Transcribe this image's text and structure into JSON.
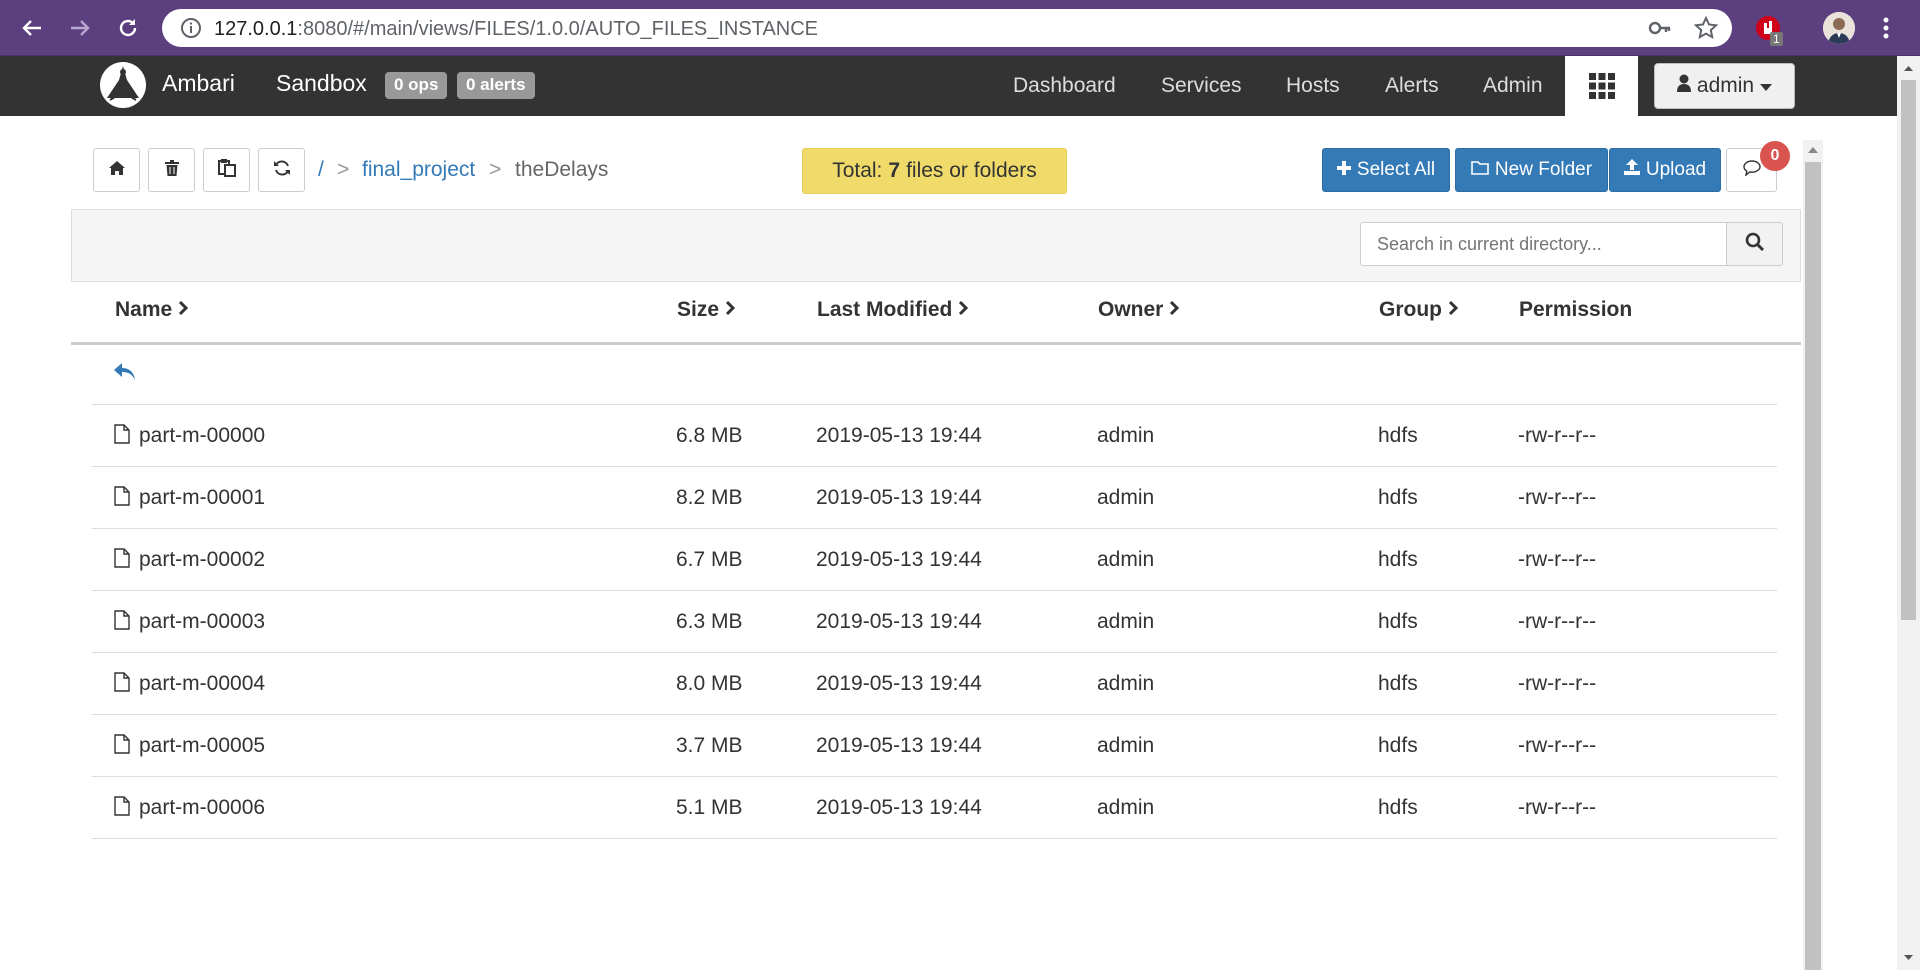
{
  "browser": {
    "url_host": "127.0.0.1",
    "url_rest": ":8080/#/main/views/FILES/1.0.0/AUTO_FILES_INSTANCE",
    "extension_badge": "1"
  },
  "nav": {
    "brand": "Ambari",
    "cluster": "Sandbox",
    "ops_badge": "0 ops",
    "alerts_badge": "0 alerts",
    "links": [
      "Dashboard",
      "Services",
      "Hosts",
      "Alerts",
      "Admin"
    ],
    "user": "admin"
  },
  "breadcrumb": {
    "root": "/",
    "sep": ">",
    "folder": "final_project",
    "current": "theDelays"
  },
  "total": {
    "prefix": "Total:",
    "count": "7",
    "suffix": "files or folders"
  },
  "toolbar": {
    "select_all": "Select All",
    "new_folder": "New Folder",
    "upload": "Upload",
    "messages_count": "0"
  },
  "search": {
    "placeholder": "Search in current directory..."
  },
  "table": {
    "headers": [
      "Name",
      "Size",
      "Last Modified",
      "Owner",
      "Group",
      "Permission"
    ],
    "rows": [
      {
        "name": "part-m-00000",
        "size": "6.8 MB",
        "modified": "2019-05-13 19:44",
        "owner": "admin",
        "group": "hdfs",
        "permission": "-rw-r--r--"
      },
      {
        "name": "part-m-00001",
        "size": "8.2 MB",
        "modified": "2019-05-13 19:44",
        "owner": "admin",
        "group": "hdfs",
        "permission": "-rw-r--r--"
      },
      {
        "name": "part-m-00002",
        "size": "6.7 MB",
        "modified": "2019-05-13 19:44",
        "owner": "admin",
        "group": "hdfs",
        "permission": "-rw-r--r--"
      },
      {
        "name": "part-m-00003",
        "size": "6.3 MB",
        "modified": "2019-05-13 19:44",
        "owner": "admin",
        "group": "hdfs",
        "permission": "-rw-r--r--"
      },
      {
        "name": "part-m-00004",
        "size": "8.0 MB",
        "modified": "2019-05-13 19:44",
        "owner": "admin",
        "group": "hdfs",
        "permission": "-rw-r--r--"
      },
      {
        "name": "part-m-00005",
        "size": "3.7 MB",
        "modified": "2019-05-13 19:44",
        "owner": "admin",
        "group": "hdfs",
        "permission": "-rw-r--r--"
      },
      {
        "name": "part-m-00006",
        "size": "5.1 MB",
        "modified": "2019-05-13 19:44",
        "owner": "admin",
        "group": "hdfs",
        "permission": "-rw-r--r--"
      }
    ]
  },
  "colors": {
    "browser_bar": "#5b3f7f",
    "topnav": "#333333",
    "primary": "#337ab7",
    "total_bg": "#f0db6a",
    "badge_red": "#d9534f"
  }
}
